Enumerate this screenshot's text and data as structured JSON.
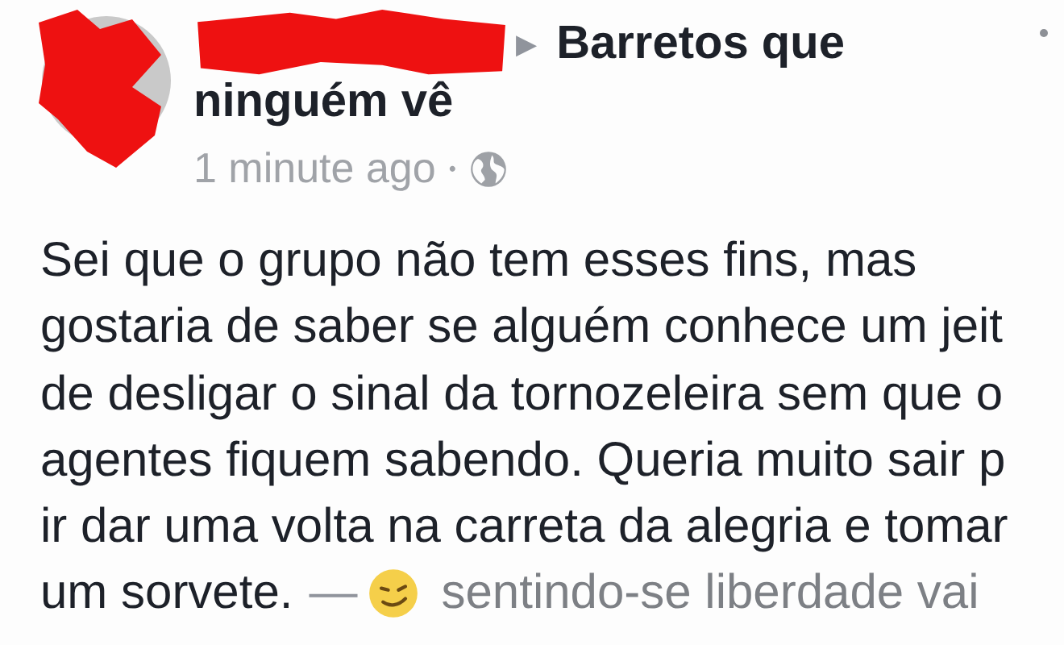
{
  "post": {
    "arrow": "▶",
    "group_lines": [
      "Barretos que",
      "ninguém vê"
    ],
    "time": "1 minute ago",
    "separator": "•",
    "lines": [
      "Sei que o grupo não tem esses fins, mas",
      "gostaria de saber se alguém conhece um jeit",
      "de desligar o sinal da tornozeleira sem que o",
      "agentes fiquem sabendo. Queria muito sair p",
      "ir dar uma volta na carreta da alegria e tomar",
      "um sorvete."
    ],
    "feeling": {
      "dash": "—",
      "text": "sentindo-se liberdade vai"
    }
  }
}
